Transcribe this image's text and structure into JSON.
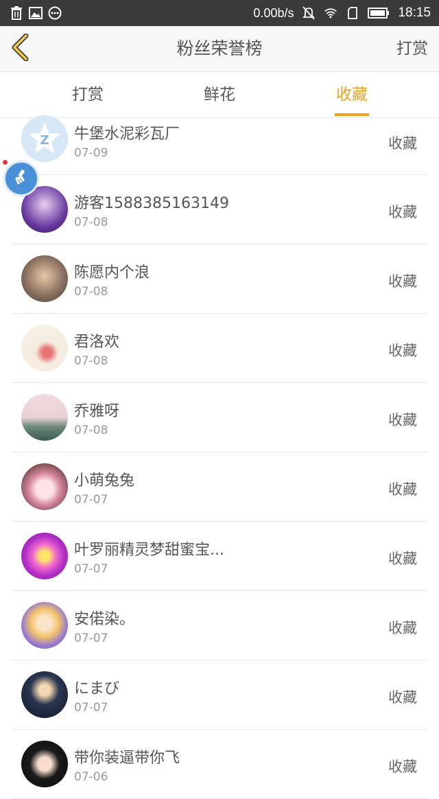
{
  "status_bar": {
    "net_speed": "0.00b/s",
    "time": "18:15",
    "icons": [
      "trash-icon",
      "image-icon",
      "more-icon",
      "mute-icon",
      "wifi-icon",
      "sim-icon",
      "battery-icon"
    ]
  },
  "header": {
    "back_icon": "chevron-left-icon",
    "title": "粉丝荣誉榜",
    "right_action": "打赏"
  },
  "tabs": [
    {
      "label": "打赏",
      "active": false
    },
    {
      "label": "鲜花",
      "active": false
    },
    {
      "label": "收藏",
      "active": true
    }
  ],
  "accent_color": "#f0a020",
  "fans": [
    {
      "name": "牛堡水泥彩瓦厂",
      "date": "07-09",
      "action": "收藏"
    },
    {
      "name": "游客1588385163149",
      "date": "07-08",
      "action": "收藏"
    },
    {
      "name": "陈愿内个浪",
      "date": "07-08",
      "action": "收藏"
    },
    {
      "name": "君洛欢",
      "date": "07-08",
      "action": "收藏"
    },
    {
      "name": "乔雅呀",
      "date": "07-08",
      "action": "收藏"
    },
    {
      "name": "小萌兔兔",
      "date": "07-07",
      "action": "收藏"
    },
    {
      "name": "叶罗丽精灵梦甜蜜宝...",
      "date": "07-07",
      "action": "收藏"
    },
    {
      "name": "安偌染。",
      "date": "07-07",
      "action": "收藏"
    },
    {
      "name": "にまび",
      "date": "07-07",
      "action": "收藏"
    },
    {
      "name": "带你装逼带你飞",
      "date": "07-06",
      "action": "收藏"
    }
  ]
}
